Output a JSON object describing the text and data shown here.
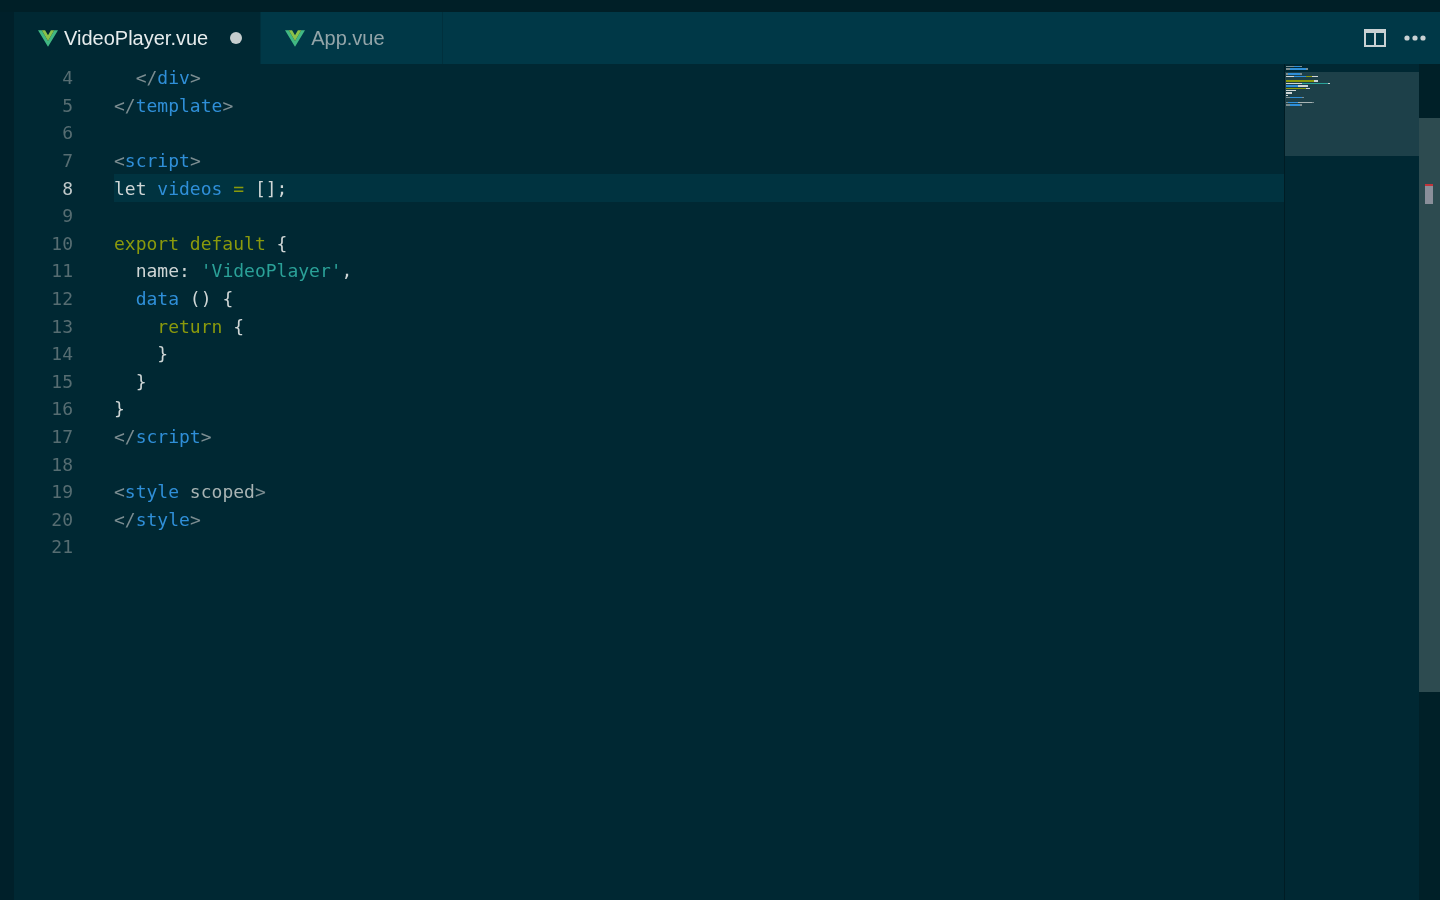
{
  "tabs": [
    {
      "label": "VideoPlayer.vue",
      "selected": true,
      "dirty": true
    },
    {
      "label": "App.vue",
      "selected": false,
      "dirty": false
    }
  ],
  "editor": {
    "lines": [
      {
        "number": "4",
        "current": false,
        "tokens": [
          {
            "kind": "punct",
            "text": "  </"
          },
          {
            "kind": "tag",
            "text": "div"
          },
          {
            "kind": "punct",
            "text": ">"
          }
        ]
      },
      {
        "number": "5",
        "current": false,
        "tokens": [
          {
            "kind": "punct",
            "text": "</"
          },
          {
            "kind": "tag",
            "text": "template"
          },
          {
            "kind": "punct",
            "text": ">"
          }
        ]
      },
      {
        "number": "6",
        "current": false
      },
      {
        "number": "7",
        "current": false,
        "tokens": [
          {
            "kind": "punct",
            "text": "<"
          },
          {
            "kind": "tag",
            "text": "script"
          },
          {
            "kind": "punct",
            "text": ">"
          }
        ]
      },
      {
        "number": "8",
        "current": true,
        "tokens": [
          {
            "kind": "plain",
            "text": "let "
          },
          {
            "kind": "ident",
            "text": "videos"
          },
          {
            "kind": "keyword",
            "text": " = "
          },
          {
            "kind": "plain",
            "text": "[]"
          },
          {
            "kind": "plain",
            "text": ";"
          }
        ]
      },
      {
        "number": "9",
        "current": false
      },
      {
        "number": "10",
        "current": false,
        "tokens": [
          {
            "kind": "keyword",
            "text": "export default"
          },
          {
            "kind": "plain",
            "text": " {"
          }
        ]
      },
      {
        "number": "11",
        "current": false,
        "tokens": [
          {
            "kind": "plain",
            "text": "  name: "
          },
          {
            "kind": "string",
            "text": "'VideoPlayer'"
          },
          {
            "kind": "plain",
            "text": ","
          }
        ]
      },
      {
        "number": "12",
        "current": false,
        "tokens": [
          {
            "kind": "ident",
            "text": "  data"
          },
          {
            "kind": "plain",
            "text": " () {"
          }
        ]
      },
      {
        "number": "13",
        "current": false,
        "tokens": [
          {
            "kind": "keyword",
            "text": "    return"
          },
          {
            "kind": "plain",
            "text": " {"
          }
        ]
      },
      {
        "number": "14",
        "current": false,
        "tokens": [
          {
            "kind": "plain",
            "text": "    }"
          }
        ]
      },
      {
        "number": "15",
        "current": false,
        "tokens": [
          {
            "kind": "plain",
            "text": "  }"
          }
        ]
      },
      {
        "number": "16",
        "current": false,
        "tokens": [
          {
            "kind": "plain",
            "text": "}"
          }
        ]
      },
      {
        "number": "17",
        "current": false,
        "tokens": [
          {
            "kind": "punct",
            "text": "</"
          },
          {
            "kind": "tag",
            "text": "script"
          },
          {
            "kind": "punct",
            "text": ">"
          }
        ]
      },
      {
        "number": "18",
        "current": false
      },
      {
        "number": "19",
        "current": false,
        "tokens": [
          {
            "kind": "punct",
            "text": "<"
          },
          {
            "kind": "tag",
            "text": "style"
          },
          {
            "kind": "attr",
            "text": " scoped"
          },
          {
            "kind": "punct",
            "text": ">"
          }
        ]
      },
      {
        "number": "20",
        "current": false,
        "tokens": [
          {
            "kind": "punct",
            "text": "</"
          },
          {
            "kind": "tag",
            "text": "style"
          },
          {
            "kind": "punct",
            "text": ">"
          }
        ]
      },
      {
        "number": "21",
        "current": false
      }
    ]
  }
}
